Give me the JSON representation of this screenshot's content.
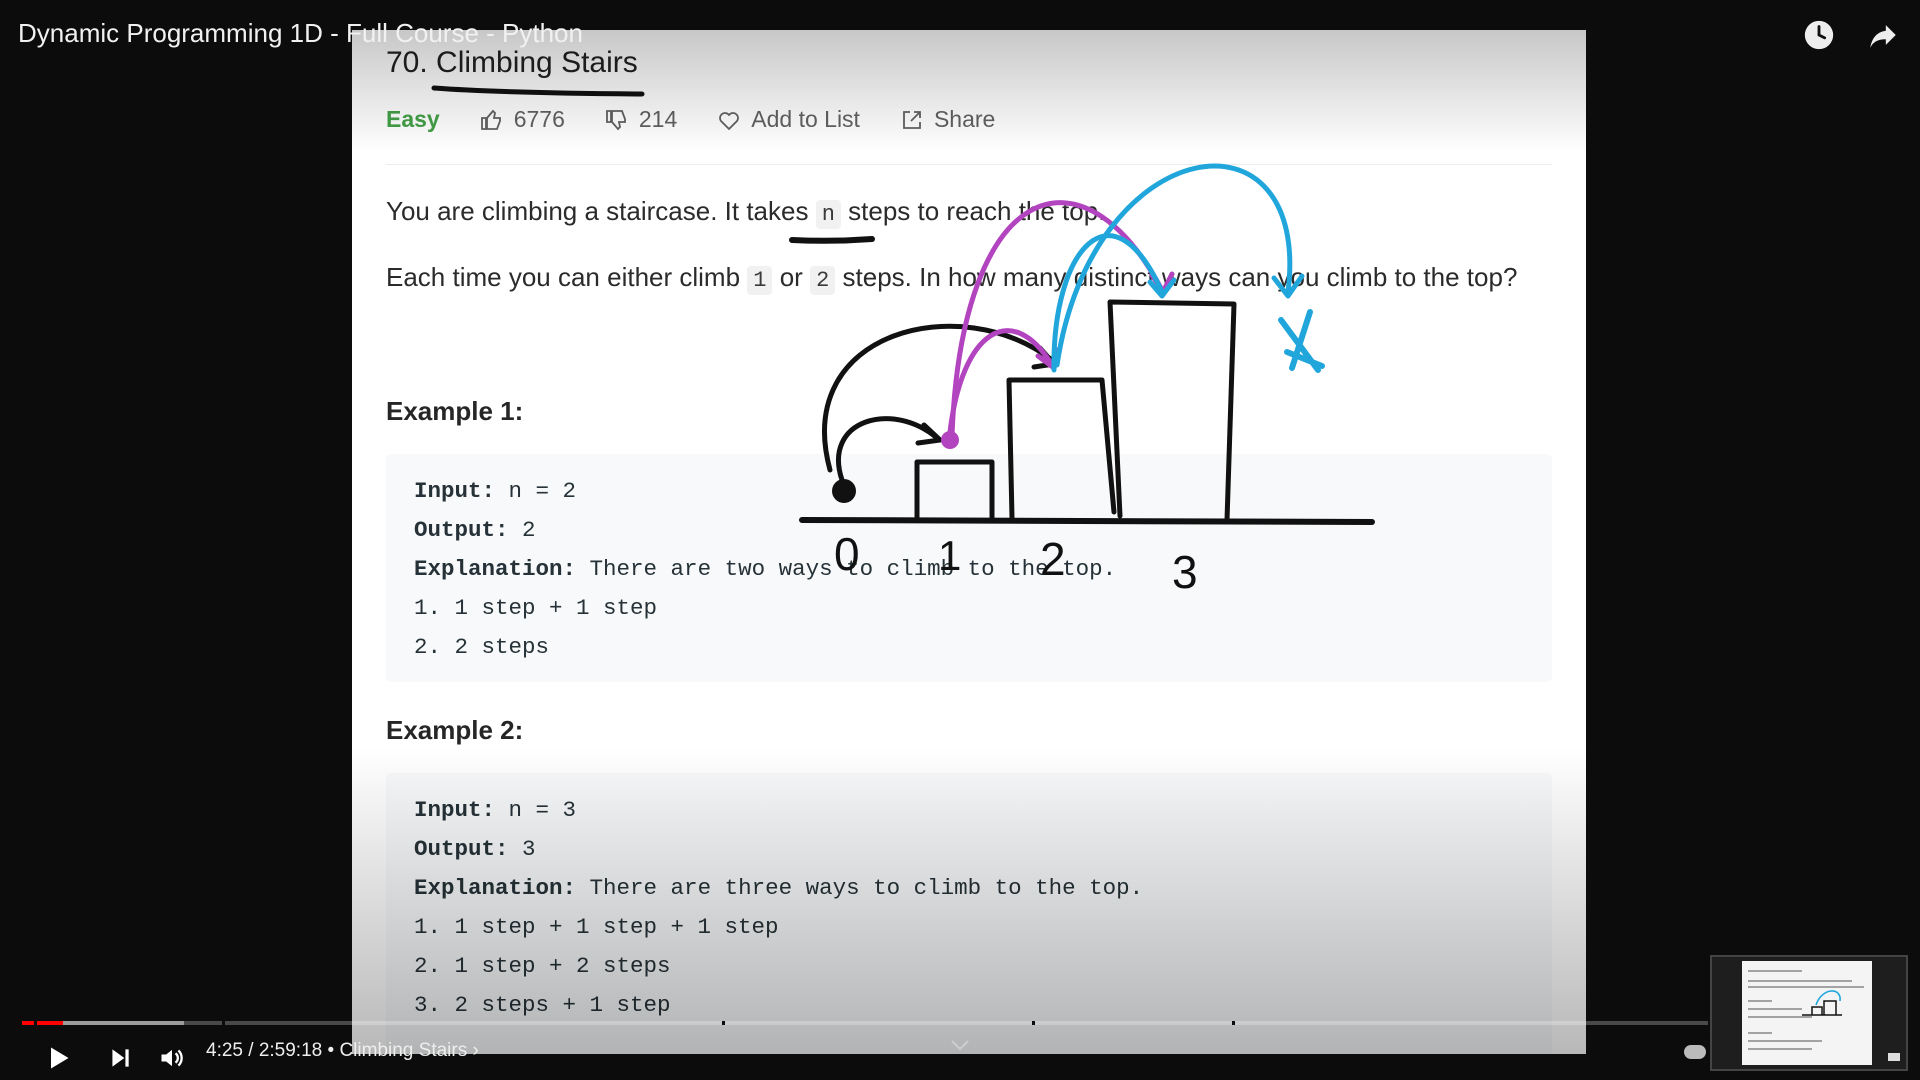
{
  "video": {
    "title": "Dynamic Programming 1D - Full Course - Python",
    "time_current": "4:25",
    "time_total": "2:59:18",
    "chapter": "Climbing Stairs",
    "progress_played_fraction": 0.0246,
    "progress_loaded_fraction": 0.096
  },
  "problem": {
    "title": "70. Climbing Stairs",
    "difficulty": "Easy",
    "likes": "6776",
    "dislikes": "214",
    "add_to_list": "Add to List",
    "share": "Share",
    "desc1_a": "You are climbing a staircase. It takes",
    "desc1_code": "n",
    "desc1_b": "steps to reach the top.",
    "desc2_a": "Each time you can either climb",
    "desc2_code1": "1",
    "desc2_or": "or",
    "desc2_code2": "2",
    "desc2_b": "steps. In how many distinct ways can you climb to the top?",
    "example1": {
      "heading": "Example 1:",
      "input_label": "Input:",
      "input_value": "n = 2",
      "output_label": "Output:",
      "output_value": "2",
      "explanation_label": "Explanation:",
      "explanation_value": "There are two ways to climb to the top.",
      "step1": "1. 1 step + 1 step",
      "step2": "2. 2 steps"
    },
    "example2": {
      "heading": "Example 2:",
      "input_label": "Input:",
      "input_value": "n = 3",
      "output_label": "Output:",
      "output_value": "3",
      "explanation_label": "Explanation:",
      "explanation_value": "There are three ways to climb to the top.",
      "step1": "1. 1 step + 1 step + 1 step",
      "step2": "2. 1 step + 2 steps",
      "step3": "3. 2 steps + 1 step"
    }
  },
  "drawing": {
    "labels": [
      "0",
      "1",
      "2",
      "3"
    ],
    "colors": {
      "black": "#111111",
      "magenta": "#b344c0",
      "blue": "#21a6dc"
    }
  }
}
